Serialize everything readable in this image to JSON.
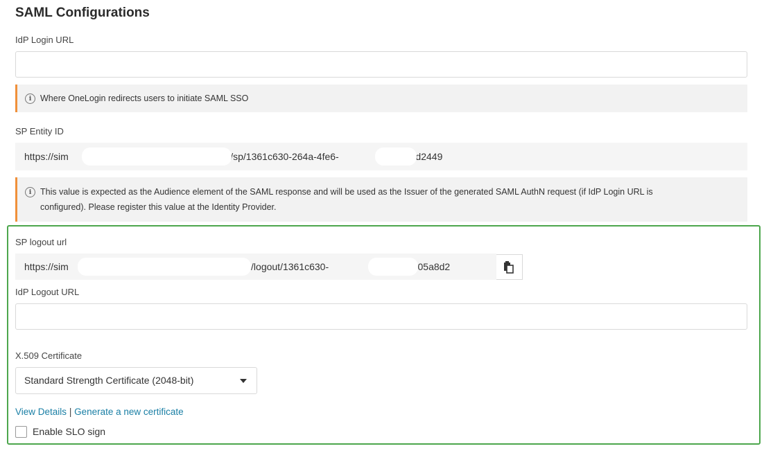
{
  "page_title": "SAML Configurations",
  "idp_login": {
    "label": "IdP Login URL",
    "value": "",
    "hint": "Where OneLogin redirects users to initiate SAML SSO"
  },
  "sp_entity": {
    "label": "SP Entity ID",
    "value_start": "https://sim",
    "value_mid": "com/sp/1361c630-264a-4fe6-",
    "value_end": "d805a8d2449",
    "hint_line1": "This value is expected as the Audience element of the SAML response and will be used as the Issuer of the generated SAML AuthN request (if IdP Login URL is",
    "hint_line2": "configured). Please register this value at the Identity Provider."
  },
  "sp_logout": {
    "label": "SP logout url",
    "value_start": "https://sim",
    "value_mid": "n/saml/logout/1361c630-",
    "value_end": "96c0-7d805a8d2",
    "copy_icon": "clipboard-icon"
  },
  "idp_logout": {
    "label": "IdP Logout URL",
    "value": ""
  },
  "certificate": {
    "label": "X.509 Certificate",
    "selected": "Standard Strength Certificate (2048-bit)",
    "view_details": "View Details",
    "separator": "|",
    "generate": "Generate a new certificate"
  },
  "slo": {
    "label": "Enable SLO sign",
    "checked": false
  },
  "colors": {
    "highlight_border": "#4ca64c",
    "hint_accent": "#f0903a",
    "link": "#1a7fa5"
  }
}
